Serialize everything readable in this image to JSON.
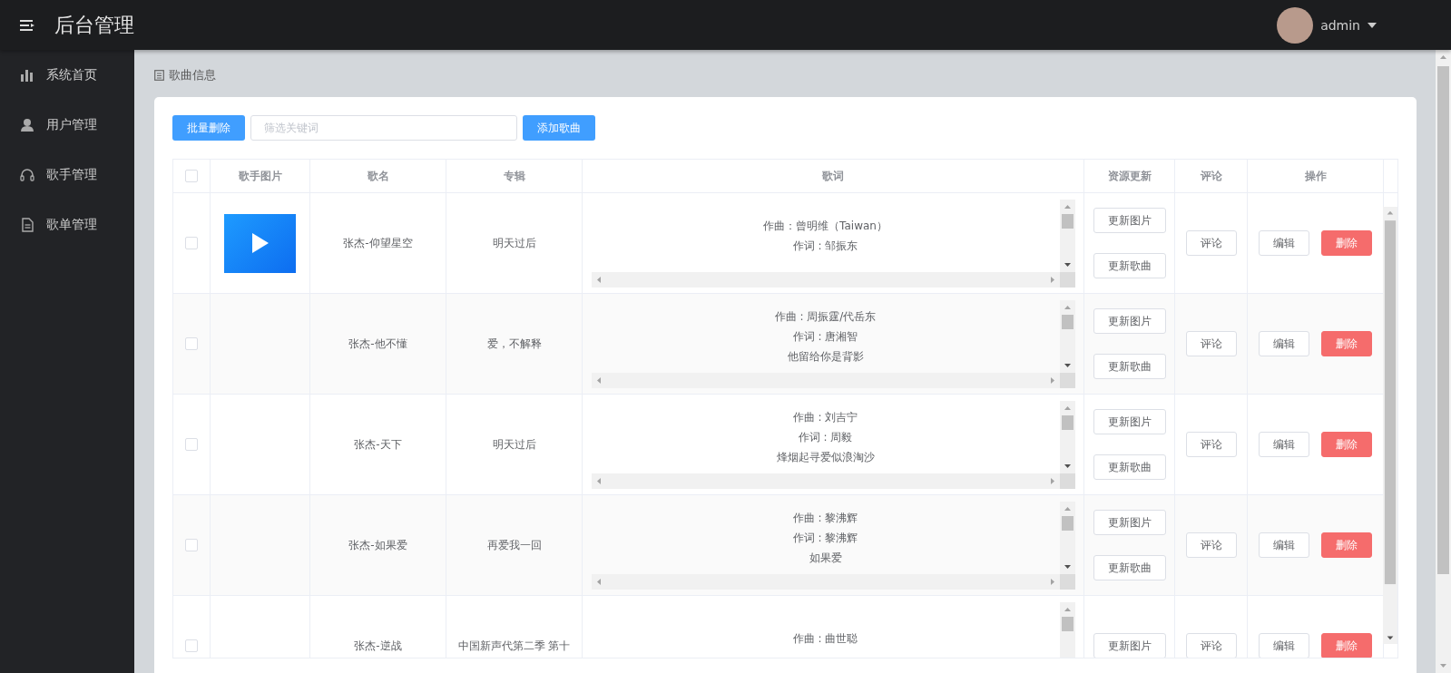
{
  "header": {
    "title": "后台管理",
    "user": {
      "name": "admin"
    }
  },
  "sidebar": {
    "items": [
      {
        "label": "系统首页",
        "selected": false
      },
      {
        "label": "用户管理",
        "selected": false
      },
      {
        "label": "歌手管理",
        "selected": false
      },
      {
        "label": "歌单管理",
        "selected": false
      }
    ]
  },
  "breadcrumb": "歌曲信息",
  "toolbar": {
    "batch_delete": "批量删除",
    "search": {
      "placeholder": "筛选关键词"
    },
    "add": "添加歌曲"
  },
  "table": {
    "select_all": {
      "checked": false
    },
    "columns": [
      "歌手图片",
      "歌名",
      "专辑",
      "歌词",
      "资源更新",
      "评论",
      "操作"
    ],
    "rows": [
      {
        "checked": false,
        "has_picture": true,
        "name": "张杰-仰望星空",
        "album": "明天过后",
        "lyrics": [
          "作曲：曾明维（Taiwan）",
          "作词 : 邹振东"
        ],
        "update_picture": "更新图片",
        "update_song": "更新歌曲",
        "comment": "评论",
        "edit": "编辑",
        "delete": "删除"
      },
      {
        "checked": false,
        "has_picture": false,
        "name": "张杰-他不懂",
        "album": "爱，不解释",
        "lyrics": [
          "作曲 : 周振霆/代岳东",
          "作词 : 唐湘智",
          "他留给你是背影"
        ],
        "update_picture": "更新图片",
        "update_song": "更新歌曲",
        "comment": "评论",
        "edit": "编辑",
        "delete": "删除"
      },
      {
        "checked": false,
        "has_picture": false,
        "name": "张杰-天下",
        "album": "明天过后",
        "lyrics": [
          "作曲 : 刘吉宁",
          "作词 : 周毅",
          "烽烟起寻爱似浪淘沙"
        ],
        "update_picture": "更新图片",
        "update_song": "更新歌曲",
        "comment": "评论",
        "edit": "编辑",
        "delete": "删除"
      },
      {
        "checked": false,
        "has_picture": false,
        "name": "张杰-如果爱",
        "album": "再爱我一回",
        "lyrics": [
          "作曲 : 黎沸辉",
          "作词 : 黎沸辉",
          "如果爱"
        ],
        "update_picture": "更新图片",
        "update_song": "更新歌曲",
        "comment": "评论",
        "edit": "编辑",
        "delete": "删除"
      },
      {
        "checked": false,
        "has_picture": false,
        "name": "张杰-逆战",
        "album": "中国新声代第二季 第十",
        "lyrics": [
          "作曲 : 曲世聪"
        ],
        "update_picture": "更新图片",
        "comment": "评论",
        "edit": "编辑",
        "delete": "删除"
      }
    ]
  }
}
